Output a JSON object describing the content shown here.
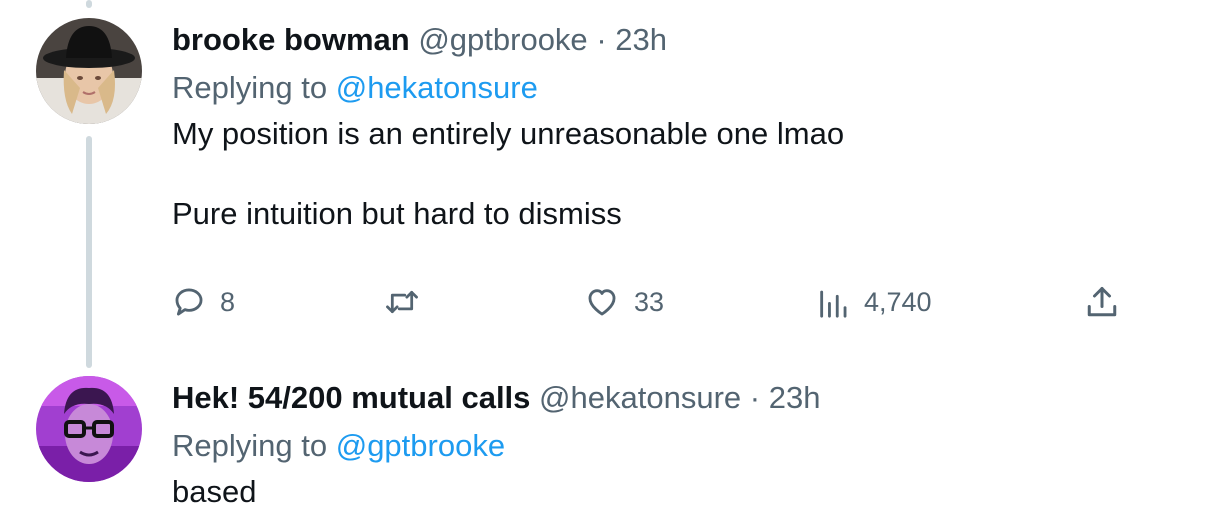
{
  "tweets": [
    {
      "display_name": "brooke bowman",
      "handle": "@gptbrooke",
      "time": "23h",
      "replying_prefix": "Replying to",
      "replying_to": "@hekatonsure",
      "text": "My position is an entirely unreasonable one lmao\n\nPure intuition but hard to dismiss",
      "actions": {
        "replies": "8",
        "retweets": "",
        "likes": "33",
        "views": "4,740"
      }
    },
    {
      "display_name": "Hek! 54/200 mutual calls",
      "handle": "@hekatonsure",
      "time": "23h",
      "replying_prefix": "Replying to",
      "replying_to": "@gptbrooke",
      "text": "based"
    }
  ],
  "separator": "·",
  "colors": {
    "text": "#0f1419",
    "secondary": "#536471",
    "link": "#1d9bf0",
    "thread_line": "#cfd9de"
  },
  "icons": [
    "reply-icon",
    "retweet-icon",
    "like-icon",
    "views-icon",
    "share-icon"
  ]
}
